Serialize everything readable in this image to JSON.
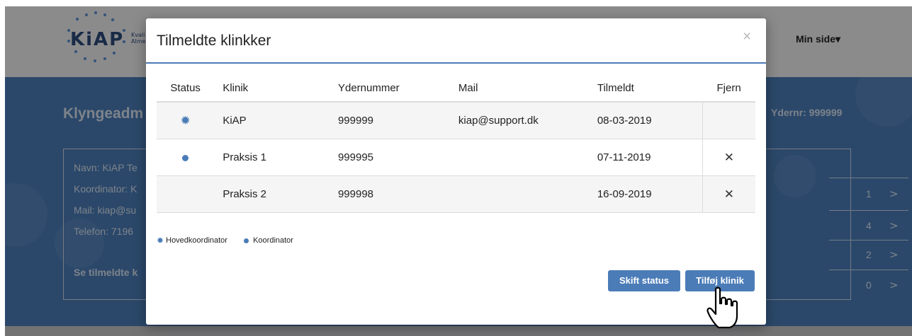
{
  "header": {
    "logo_text": "KiAP",
    "logo_sub_line1": "Kvali",
    "logo_sub_line2": "Alme",
    "min_side": "Min side▾"
  },
  "background": {
    "page_title": "Klyngeadm",
    "ydernr": "Ydernr: 999999",
    "info_lines": [
      "Navn: KiAP Te",
      "Koordinator: K",
      "Mail: kiap@su",
      "Telefon: 7196"
    ],
    "link_text": "Se tilmeldte k",
    "counts": [
      "1",
      "4",
      "2",
      "0"
    ]
  },
  "modal": {
    "title": "Tilmeldte klinkker",
    "close": "×",
    "columns": [
      "Status",
      "Klinik",
      "Ydernummer",
      "Mail",
      "Tilmeldt",
      "Fjern"
    ],
    "rows": [
      {
        "status": "hovedkoordinator",
        "klinik": "KiAP",
        "ydernummer": "999999",
        "mail": "kiap@support.dk",
        "tilmeldt": "08-03-2019",
        "fjern": ""
      },
      {
        "status": "koordinator",
        "klinik": "Praksis 1",
        "ydernummer": "999995",
        "mail": "",
        "tilmeldt": "07-11-2019",
        "fjern": "✕"
      },
      {
        "status": "",
        "klinik": "Praksis 2",
        "ydernummer": "999998",
        "mail": "",
        "tilmeldt": "16-09-2019",
        "fjern": "✕"
      }
    ],
    "legend": {
      "hoved": "Hovedkoordinator",
      "koord": "Koordinator"
    },
    "buttons": {
      "skift": "Skift status",
      "tilfoej": "Tilføj klinik"
    }
  },
  "colors": {
    "accent": "#4b7cb7"
  }
}
